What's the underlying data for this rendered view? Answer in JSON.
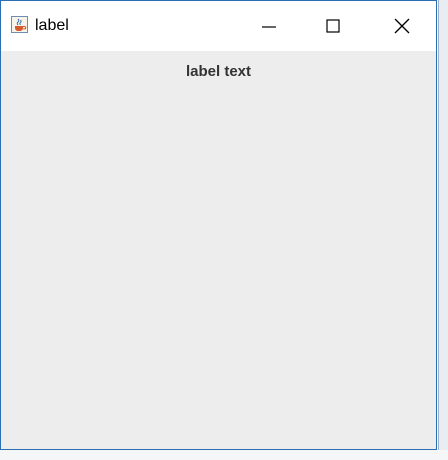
{
  "window": {
    "title": "label",
    "icon": "java-cup-icon",
    "controls": [
      "minimize-icon",
      "maximize-icon",
      "close-icon"
    ],
    "accent_border": "#2b6fb3",
    "content_background": "#ededed"
  },
  "content": {
    "label": "label text"
  }
}
